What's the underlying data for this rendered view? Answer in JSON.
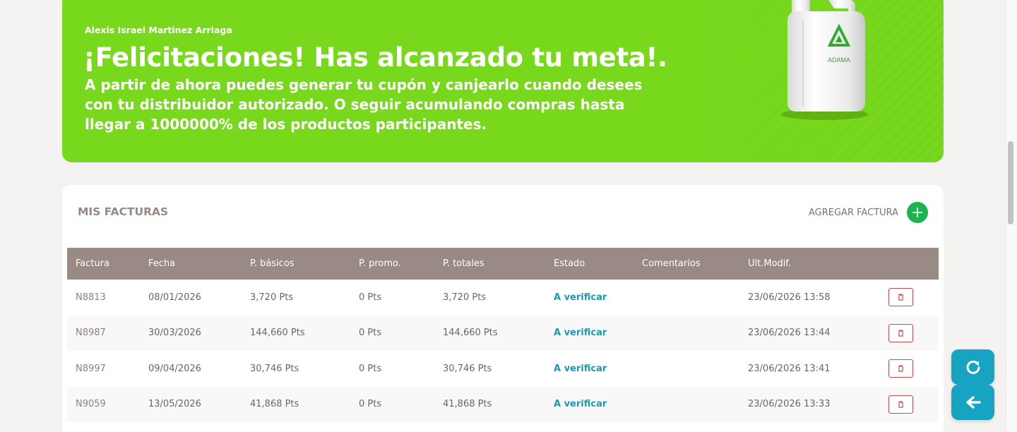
{
  "banner": {
    "user_name": "Alexis Israel Martinez Arriaga",
    "headline": "¡Felicitaciones! Has alcanzado tu meta!.",
    "message": "A partir de ahora puedes generar tu cupón y canjearlo cuando desees con tu distribuidor autorizado. O seguir acumulando compras hasta llegar a 1000000% de los productos participantes.",
    "jug_brand": "ADAMA"
  },
  "invoices": {
    "title": "MIS FACTURAS",
    "add_label": "AGREGAR FACTURA",
    "columns": [
      "Factura",
      "Fecha",
      "P. básicos",
      "P. promo.",
      "P. totales",
      "Estado",
      "Comentarios",
      "Ult.Modif."
    ],
    "rows": [
      {
        "invoice": "N8813",
        "date": "08/01/2026",
        "basic": "3,720 Pts",
        "promo": "0 Pts",
        "total": "3,720 Pts",
        "status": "A verificar",
        "comments": "",
        "modified": "23/06/2026 13:58"
      },
      {
        "invoice": "N8987",
        "date": "30/03/2026",
        "basic": "144,660 Pts",
        "promo": "0 Pts",
        "total": "144,660 Pts",
        "status": "A verificar",
        "comments": "",
        "modified": "23/06/2026 13:44"
      },
      {
        "invoice": "N8997",
        "date": "09/04/2026",
        "basic": "30,746 Pts",
        "promo": "0 Pts",
        "total": "30,746 Pts",
        "status": "A verificar",
        "comments": "",
        "modified": "23/06/2026 13:41"
      },
      {
        "invoice": "N9059",
        "date": "13/05/2026",
        "basic": "41,868 Pts",
        "promo": "0 Pts",
        "total": "41,868 Pts",
        "status": "A verificar",
        "comments": "",
        "modified": "23/06/2026 13:33"
      }
    ]
  },
  "icons": {
    "add": "plus-icon",
    "delete": "trash-icon",
    "refresh": "refresh-icon",
    "back": "arrow-left-icon"
  },
  "colors": {
    "banner_green": "#78d91c",
    "header_taupe": "#998a85",
    "status_teal": "#1a9bb4",
    "add_green": "#1db34f",
    "fab_teal": "#17a4c2",
    "delete_red": "#d04a4a"
  }
}
